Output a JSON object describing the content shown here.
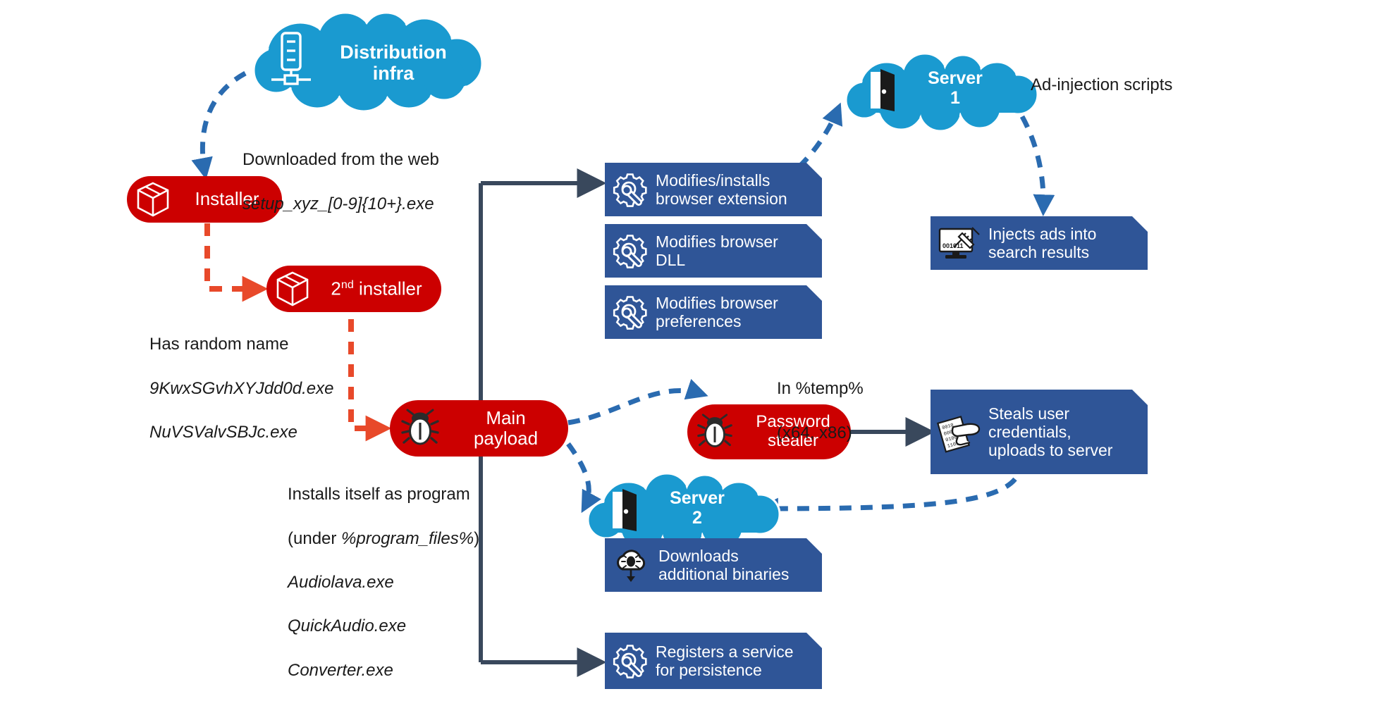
{
  "colors": {
    "red_node": "#cc0000",
    "blue_box": "#2f5597",
    "cloud": "#1a9ad0",
    "connector_dark": "#39485c",
    "dashed_blue": "#2a6bb0",
    "dashed_red": "#e8492a",
    "text": "#1a1a1a",
    "background": "#ffffff"
  },
  "nodes": {
    "distribution_infra": {
      "label": "Distribution\ninfra",
      "icon": "server-icon",
      "type": "cloud"
    },
    "server_1": {
      "label": "Server\n1",
      "icon": "door-icon",
      "type": "cloud"
    },
    "server_2": {
      "label": "Server\n2",
      "icon": "door-icon",
      "type": "cloud"
    },
    "installer": {
      "label": "Installer",
      "icon": "package-icon",
      "type": "pill"
    },
    "second_installer": {
      "label": "2nd installer",
      "label_base": "2",
      "label_sup": "nd",
      "label_rest": " installer",
      "icon": "package-icon",
      "type": "pill"
    },
    "main_payload": {
      "label": "Main\npayload",
      "icon": "bug-icon",
      "type": "pill"
    },
    "password_stealer": {
      "label": "Password\nstealer",
      "icon": "bug-icon",
      "type": "pill"
    }
  },
  "actions": [
    {
      "id": "browser-extension",
      "label": "Modifies/installs\nbrowser extension",
      "icon": "gear-wrench-icon"
    },
    {
      "id": "browser-dll",
      "label": "Modifies browser\nDLL",
      "icon": "gear-wrench-icon"
    },
    {
      "id": "browser-preferences",
      "label": "Modifies browser\npreferences",
      "icon": "gear-wrench-icon"
    },
    {
      "id": "inject-ads",
      "label": "Injects ads into\nsearch results",
      "icon": "monitor-syringe-icon",
      "icon_text": "001011"
    },
    {
      "id": "steal-credentials",
      "label": "Steals user\ncredentials,\nuploads to server",
      "icon": "hand-document-icon"
    },
    {
      "id": "download-binaries",
      "label": "Downloads\nadditional binaries",
      "icon": "cloud-download-bug-icon"
    },
    {
      "id": "register-service",
      "label": "Registers a service\nfor persistence",
      "icon": "gear-wrench-icon"
    }
  ],
  "annotations": {
    "downloaded_from_web": {
      "line1": "Downloaded from the web",
      "line2": "setup_xyz_[0-9]{10+}.exe"
    },
    "random_name": {
      "line1": "Has random name",
      "line2": "9KwxSGvhXYJdd0d.exe",
      "line3": "NuVSValvSBJc.exe"
    },
    "installs_itself": {
      "line1": "Installs itself as program",
      "line2_pre": "(under ",
      "line2_it": "%program_files%",
      "line2_post": ")",
      "line3": "Audiolava.exe",
      "line4": "QuickAudio.exe",
      "line5": "Converter.exe"
    },
    "ad_injection_scripts": {
      "text": "Ad-injection scripts"
    },
    "in_temp": {
      "line1": "In %temp%",
      "line2": "(x64, x86)"
    }
  }
}
